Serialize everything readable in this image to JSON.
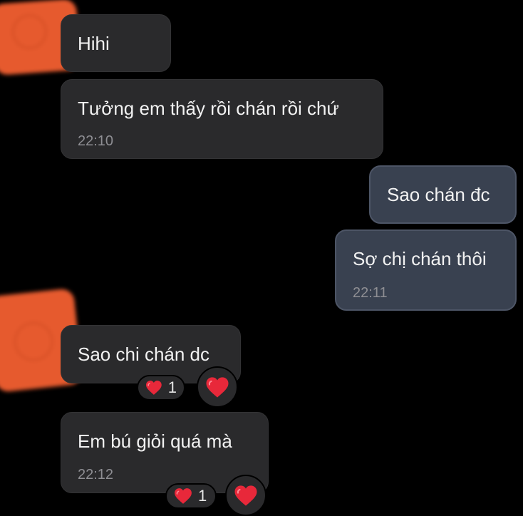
{
  "messages": [
    {
      "id": "m1",
      "direction": "incoming",
      "text": "Hihi",
      "time": ""
    },
    {
      "id": "m2",
      "direction": "incoming",
      "text": "Tưởng em thấy rồi chán rồi chứ",
      "time": "22:10"
    },
    {
      "id": "m3",
      "direction": "outgoing",
      "text": "Sao chán đc",
      "time": ""
    },
    {
      "id": "m4",
      "direction": "outgoing",
      "text": "Sợ chị chán thôi",
      "time": "22:11"
    },
    {
      "id": "m5",
      "direction": "incoming",
      "text": "Sao chi chán dc",
      "time": "",
      "reaction": {
        "icon": "heart-icon",
        "count": "1"
      }
    },
    {
      "id": "m6",
      "direction": "incoming",
      "text": "Em bú giỏi quá mà",
      "time": "22:12",
      "reaction": {
        "icon": "heart-icon",
        "count": "1"
      }
    }
  ],
  "colors": {
    "background": "#000000",
    "incoming_bubble": "#2a2a2c",
    "outgoing_bubble": "#394150",
    "outgoing_border": "#4d5566",
    "timestamp": "#8e8e93",
    "heart": "#e8283a",
    "avatar_blur": "#e65a2e"
  }
}
